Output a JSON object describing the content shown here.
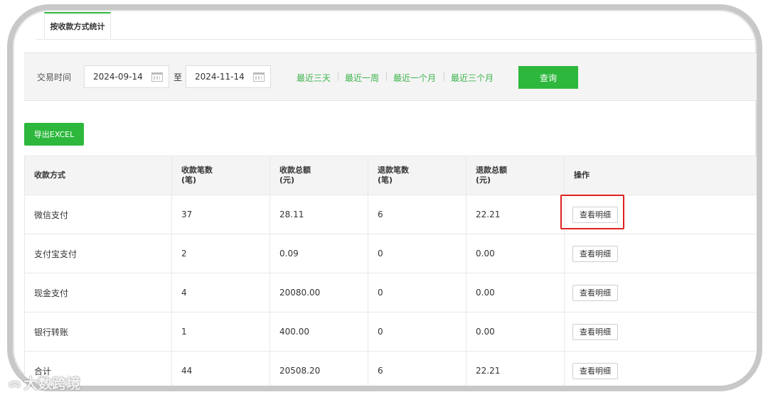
{
  "tabs": [
    {
      "label": "按收款方式统计"
    }
  ],
  "filter": {
    "label": "交易时间",
    "start_date": "2024-09-14",
    "separator": "至",
    "end_date": "2024-11-14",
    "quick_ranges": [
      "最近三天",
      "最近一周",
      "最近一个月",
      "最近三个月"
    ],
    "query_label": "查询"
  },
  "export_label": "导出EXCEL",
  "table": {
    "headers": [
      {
        "line1": "收款方式",
        "line2": ""
      },
      {
        "line1": "收款笔数",
        "line2": "(笔)"
      },
      {
        "line1": "收款总额",
        "line2": "(元)"
      },
      {
        "line1": "退款笔数",
        "line2": "(笔)"
      },
      {
        "line1": "退款总额",
        "line2": "(元)"
      },
      {
        "line1": "操作",
        "line2": ""
      }
    ],
    "rows": [
      {
        "method": "微信支付",
        "count": "37",
        "total": "28.11",
        "refund_count": "6",
        "refund_total": "22.21",
        "action": "查看明细"
      },
      {
        "method": "支付宝支付",
        "count": "2",
        "total": "0.09",
        "refund_count": "0",
        "refund_total": "0.00",
        "action": "查看明细"
      },
      {
        "method": "现金支付",
        "count": "4",
        "total": "20080.00",
        "refund_count": "0",
        "refund_total": "0.00",
        "action": "查看明细"
      },
      {
        "method": "银行转账",
        "count": "1",
        "total": "400.00",
        "refund_count": "0",
        "refund_total": "0.00",
        "action": "查看明细"
      },
      {
        "method": "合计",
        "count": "44",
        "total": "20508.20",
        "refund_count": "6",
        "refund_total": "22.21",
        "action": "查看明细"
      }
    ]
  },
  "watermark": "大数跨境",
  "colors": {
    "accent": "#2db83d",
    "highlight": "#e02020"
  },
  "icons": {
    "date": "calendar-icon"
  }
}
